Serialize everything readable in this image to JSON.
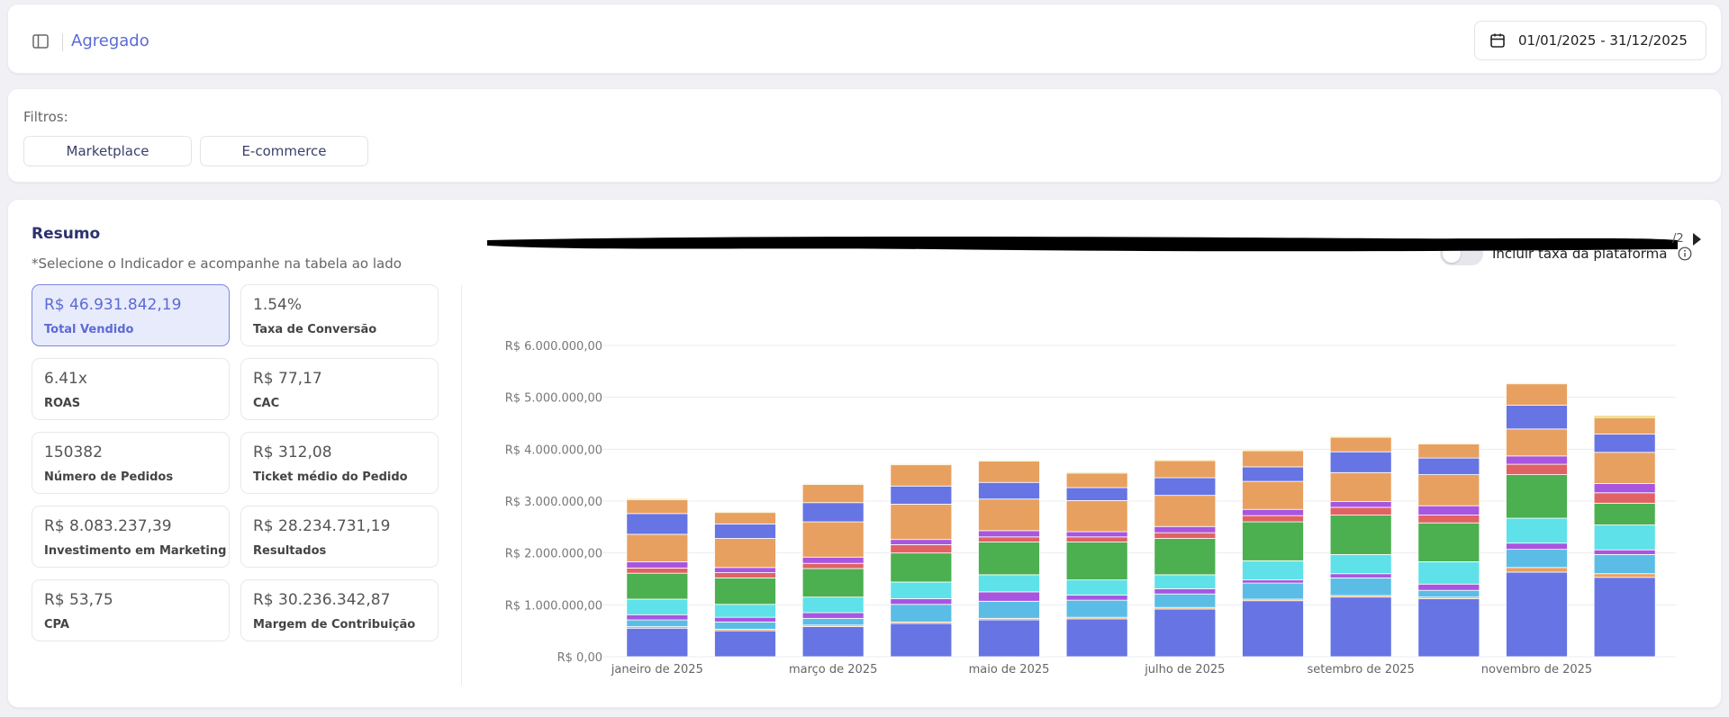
{
  "header": {
    "title": "Agregado",
    "date_range": "01/01/2025 - 31/12/2025"
  },
  "filters": {
    "label": "Filtros:",
    "buttons": [
      "Marketplace",
      "E-commerce"
    ]
  },
  "summary": {
    "title": "Resumo",
    "subtitle": "*Selecione o Indicador e acompanhe na tabela ao lado",
    "toggle_label": "Incluir taxa da plataforma",
    "toggle_on": false,
    "page_indicator": "/2",
    "kpis": [
      {
        "value": "R$ 46.931.842,19",
        "label": "Total Vendido",
        "active": true
      },
      {
        "value": "1.54%",
        "label": "Taxa de Conversão"
      },
      {
        "value": "6.41x",
        "label": "ROAS"
      },
      {
        "value": "R$ 77,17",
        "label": "CAC"
      },
      {
        "value": "150382",
        "label": "Número de Pedidos"
      },
      {
        "value": "R$ 312,08",
        "label": "Ticket médio do Pedido"
      },
      {
        "value": "R$ 8.083.237,39",
        "label": "Investimento em Marketing"
      },
      {
        "value": "R$ 28.234.731,19",
        "label": "Resultados"
      },
      {
        "value": "R$ 53,75",
        "label": "CPA"
      },
      {
        "value": "R$ 30.236.342,87",
        "label": "Margem de Contribuição"
      }
    ]
  },
  "colors": {
    "accent": "#5b6ad6",
    "series": [
      "#6674e4",
      "#e8a060",
      "#5bbde6",
      "#a855e0",
      "#5ee1e8",
      "#4caf50",
      "#e06262",
      "#a855e0",
      "#e8a060",
      "#6674e4",
      "#e8a060",
      "#e8d86a"
    ]
  },
  "chart_data": {
    "type": "bar",
    "stacked": true,
    "title": "",
    "xlabel": "",
    "ylabel": "",
    "ylim": [
      0,
      6000000
    ],
    "yticks": [
      0,
      1000000,
      2000000,
      3000000,
      4000000,
      5000000,
      6000000
    ],
    "ytick_labels": [
      "R$ 0,00",
      "R$ 1.000.000,00",
      "R$ 2.000.000,00",
      "R$ 3.000.000,00",
      "R$ 4.000.000,00",
      "R$ 5.000.000,00",
      "R$ 6.000.000,00"
    ],
    "categories": [
      "janeiro de 2025",
      "fevereiro de 2025",
      "março de 2025",
      "abril de 2025",
      "maio de 2025",
      "junho de 2025",
      "julho de 2025",
      "agosto de 2025",
      "setembro de 2025",
      "outubro de 2025",
      "novembro de 2025",
      "dezembro de 2025"
    ],
    "category_tick_labels": [
      "janeiro de 2025",
      "",
      "março de 2025",
      "",
      "maio de 2025",
      "",
      "julho de 2025",
      "",
      "setembro de 2025",
      "",
      "novembro de 2025",
      ""
    ],
    "grid": true,
    "legend": "none",
    "series": [
      {
        "values": [
          550000,
          500000,
          580000,
          640000,
          710000,
          730000,
          920000,
          1080000,
          1150000,
          1120000,
          1630000,
          1530000
        ]
      },
      {
        "values": [
          30000,
          30000,
          30000,
          30000,
          30000,
          30000,
          30000,
          30000,
          30000,
          30000,
          90000,
          70000
        ]
      },
      {
        "values": [
          130000,
          140000,
          130000,
          340000,
          330000,
          330000,
          260000,
          310000,
          340000,
          130000,
          350000,
          370000
        ]
      },
      {
        "values": [
          100000,
          90000,
          110000,
          110000,
          180000,
          100000,
          100000,
          60000,
          80000,
          120000,
          120000,
          90000
        ]
      },
      {
        "values": [
          300000,
          250000,
          300000,
          320000,
          330000,
          290000,
          270000,
          370000,
          370000,
          430000,
          480000,
          480000
        ]
      },
      {
        "values": [
          500000,
          510000,
          550000,
          560000,
          630000,
          730000,
          700000,
          750000,
          760000,
          750000,
          840000,
          420000
        ]
      },
      {
        "values": [
          100000,
          100000,
          100000,
          160000,
          100000,
          100000,
          110000,
          120000,
          150000,
          150000,
          200000,
          200000
        ]
      },
      {
        "values": [
          120000,
          100000,
          120000,
          100000,
          120000,
          100000,
          120000,
          120000,
          110000,
          180000,
          160000,
          180000
        ]
      },
      {
        "values": [
          530000,
          560000,
          680000,
          680000,
          610000,
          600000,
          600000,
          540000,
          560000,
          600000,
          520000,
          600000
        ]
      },
      {
        "values": [
          400000,
          280000,
          370000,
          350000,
          320000,
          250000,
          340000,
          280000,
          400000,
          320000,
          460000,
          350000
        ]
      },
      {
        "values": [
          270000,
          220000,
          350000,
          410000,
          410000,
          280000,
          330000,
          310000,
          280000,
          270000,
          410000,
          320000
        ]
      },
      {
        "values": [
          20000,
          20000,
          20000,
          20000,
          20000,
          20000,
          20000,
          20000,
          20000,
          20000,
          20000,
          40000
        ]
      }
    ]
  }
}
